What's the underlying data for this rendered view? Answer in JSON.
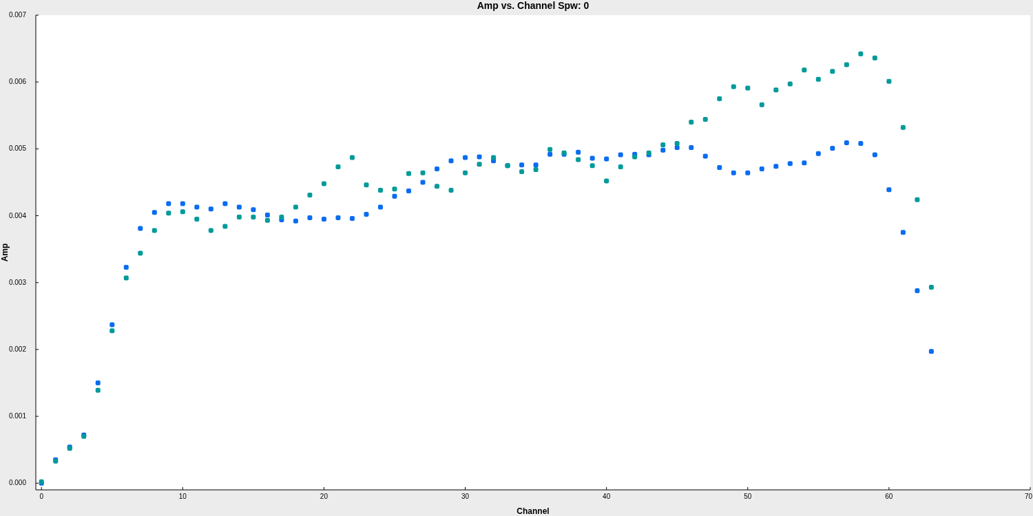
{
  "chart_data": {
    "type": "scatter",
    "title": "Amp vs. Channel Spw: 0",
    "xlabel": "Channel",
    "ylabel": "Amp",
    "x": [
      0,
      1,
      2,
      3,
      4,
      5,
      6,
      7,
      8,
      9,
      10,
      11,
      12,
      13,
      14,
      15,
      16,
      17,
      18,
      19,
      20,
      21,
      22,
      23,
      24,
      25,
      26,
      27,
      28,
      29,
      30,
      31,
      32,
      33,
      34,
      35,
      36,
      37,
      38,
      39,
      40,
      41,
      42,
      43,
      44,
      45,
      46,
      47,
      48,
      49,
      50,
      51,
      52,
      53,
      54,
      55,
      56,
      57,
      58,
      59,
      60,
      61,
      62,
      63
    ],
    "series": [
      {
        "color": "#0a6cf0",
        "values": [
          0,
          0.00035,
          0.00054,
          0.00072,
          0.0015,
          0.00237,
          0.00323,
          0.00381,
          0.00405,
          0.00418,
          0.00418,
          0.00413,
          0.0041,
          0.00418,
          0.00413,
          0.00409,
          0.00401,
          0.00394,
          0.00392,
          0.00397,
          0.00395,
          0.00397,
          0.00396,
          0.00402,
          0.00413,
          0.00429,
          0.00437,
          0.0045,
          0.0047,
          0.00482,
          0.00487,
          0.00488,
          0.00482,
          0.00475,
          0.00476,
          0.00476,
          0.00492,
          0.00492,
          0.00495,
          0.00486,
          0.00485,
          0.00491,
          0.00492,
          0.00491,
          0.00498,
          0.00502,
          0.00502,
          0.00489,
          0.00472,
          0.00464,
          0.00464,
          0.0047,
          0.00474,
          0.00478,
          0.00479,
          0.00493,
          0.00501,
          0.00509,
          0.00508,
          0.00491,
          0.00439,
          0.00375,
          0.00288,
          0.00197
        ]
      },
      {
        "color": "#009a9a",
        "values": [
          2e-05,
          0.00033,
          0.00052,
          0.0007,
          0.00139,
          0.00228,
          0.00307,
          0.00344,
          0.00378,
          0.00404,
          0.00406,
          0.00395,
          0.00378,
          0.00384,
          0.00398,
          0.00398,
          0.00393,
          0.00398,
          0.00413,
          0.00431,
          0.00448,
          0.00473,
          0.00487,
          0.00446,
          0.00438,
          0.0044,
          0.00463,
          0.00464,
          0.00444,
          0.00438,
          0.00464,
          0.00477,
          0.00487,
          0.00475,
          0.00466,
          0.00469,
          0.00499,
          0.00494,
          0.00484,
          0.00475,
          0.00452,
          0.00473,
          0.00488,
          0.00494,
          0.00506,
          0.00508,
          0.0054,
          0.00544,
          0.00575,
          0.00593,
          0.00591,
          0.00566,
          0.00588,
          0.00597,
          0.00618,
          0.00604,
          0.00616,
          0.00626,
          0.00642,
          0.00636,
          0.00601,
          0.00532,
          0.00424,
          0.00293
        ]
      }
    ],
    "xlim": [
      -0.4,
      70
    ],
    "ylim": [
      -0.0001,
      0.007
    ],
    "xticks": [
      0,
      10,
      20,
      30,
      40,
      50,
      60,
      70
    ],
    "yticks": [
      {
        "value": 0,
        "label": "0.000"
      },
      {
        "value": 0.001,
        "label": "0.001"
      },
      {
        "value": 0.002,
        "label": "0.002"
      },
      {
        "value": 0.003,
        "label": "0.003"
      },
      {
        "value": 0.004,
        "label": "0.004"
      },
      {
        "value": 0.005,
        "label": "0.005"
      },
      {
        "value": 0.006,
        "label": "0.006"
      },
      {
        "value": 0.007,
        "label": "0.007"
      }
    ]
  }
}
